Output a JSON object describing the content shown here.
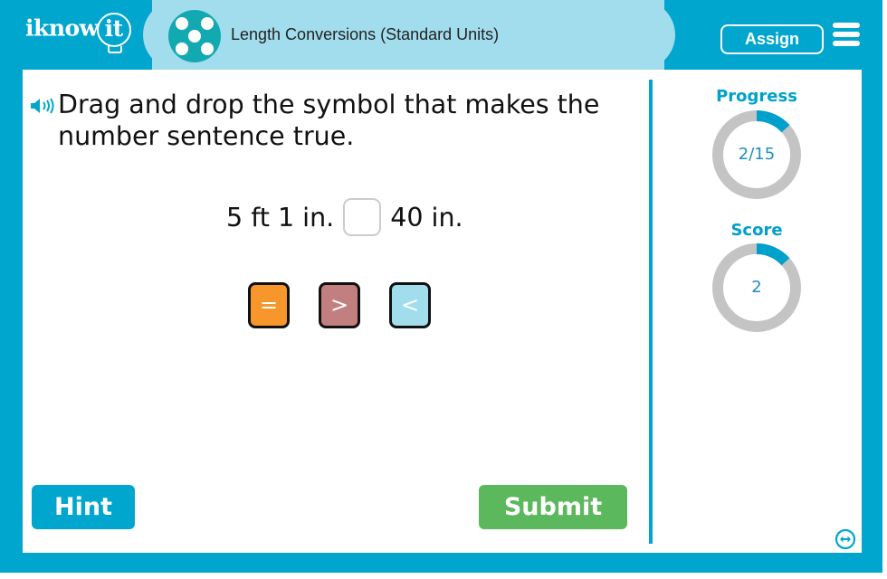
{
  "header": {
    "logo_text": "iknow",
    "logo_bulb_text": "it",
    "topic_title": "Length Conversions (Standard Units)",
    "topic_icon": "dots-pattern-icon",
    "assign_label": "Assign",
    "menu_icon": "hamburger-menu-icon"
  },
  "question": {
    "speaker_icon": "speaker-icon",
    "prompt": "Drag and drop the symbol that makes the number sentence true.",
    "left_expression": "5 ft 1 in.",
    "right_expression": "40 in.",
    "drop_target_value": ""
  },
  "symbols": [
    {
      "label": "=",
      "color": "#F7962B"
    },
    {
      "label": ">",
      "color": "#C27F7F"
    },
    {
      "label": "<",
      "color": "#A2DDEE"
    }
  ],
  "sidebar": {
    "progress_label": "Progress",
    "progress_text": "2/15",
    "progress_current": 2,
    "progress_total": 15,
    "score_label": "Score",
    "score_text": "2",
    "score_arc_fraction": 0.133
  },
  "footer": {
    "hint_label": "Hint",
    "submit_label": "Submit",
    "expand_icon": "expand-horizontal-icon"
  },
  "colors": {
    "brand": "#00A6CE",
    "topic_bar": "#A2DDEE",
    "ring_track": "#C4C4C4",
    "ring_fill": "#00A0CC",
    "submit": "#5CB85C"
  }
}
